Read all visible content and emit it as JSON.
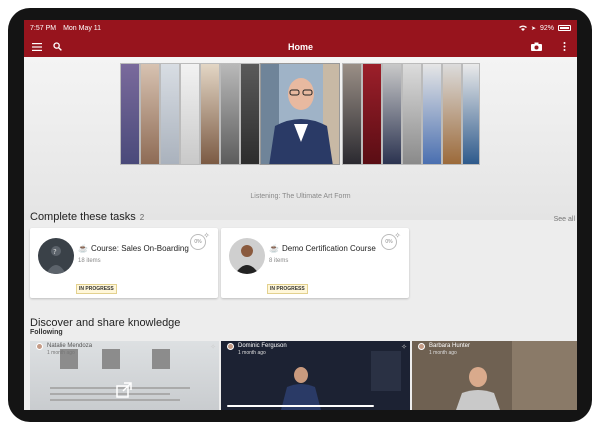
{
  "statusbar": {
    "time": "7:57 PM",
    "date": "Mon May 11",
    "battery": "92%"
  },
  "navbar": {
    "title": "Home",
    "icons": [
      "menu-icon",
      "search-icon",
      "camera-icon",
      "more-vertical-icon"
    ]
  },
  "carousel": {
    "caption": "Listening: The Ultimate Art Form"
  },
  "tasks": {
    "title": "Complete these tasks",
    "count": "2",
    "see_all": "See all",
    "items": [
      {
        "name": "Course: Sales On-Boarding",
        "items": "18 items",
        "status": "IN PROGRESS",
        "progress": "0%"
      },
      {
        "name": "Demo Certification Course",
        "items": "8 items",
        "status": "IN PROGRESS",
        "progress": "0%"
      }
    ]
  },
  "discover": {
    "title": "Discover and share knowledge",
    "subtitle": "Following",
    "posts": [
      {
        "author": "Natalie Mendoza",
        "ago": "1 month ago"
      },
      {
        "author": "Dominic Ferguson",
        "ago": "1 month ago"
      },
      {
        "author": "Barbara Hunter",
        "ago": "1 month ago"
      }
    ]
  },
  "colors": {
    "brand": "#97141d"
  }
}
